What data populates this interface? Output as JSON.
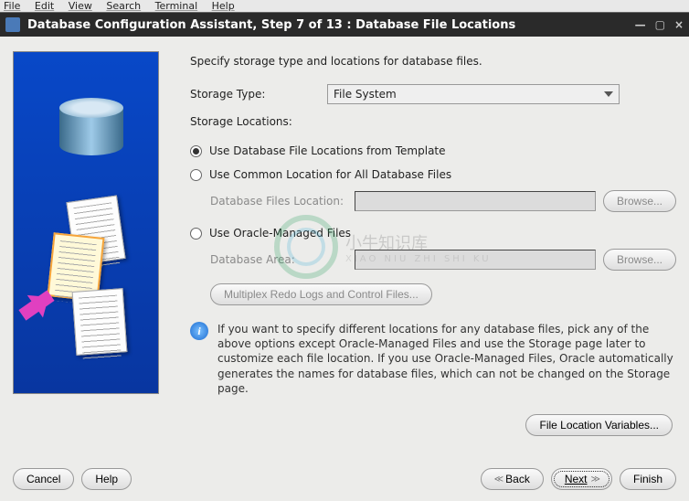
{
  "menubar": [
    "File",
    "Edit",
    "View",
    "Search",
    "Terminal",
    "Help"
  ],
  "window": {
    "title": "Database Configuration Assistant, Step 7 of 13 : Database File Locations"
  },
  "instruction": "Specify storage type and locations for database files.",
  "storage_type": {
    "label": "Storage Type:",
    "value": "File System"
  },
  "storage_locations_label": "Storage Locations:",
  "radios": {
    "template": "Use Database File Locations from Template",
    "common": "Use Common Location for All Database Files",
    "omf": "Use Oracle-Managed Files"
  },
  "common": {
    "label": "Database Files Location:",
    "value": "",
    "browse": "Browse..."
  },
  "omf": {
    "label": "Database Area:",
    "value": "",
    "browse": "Browse..."
  },
  "multiplex": "Multiplex Redo Logs and Control Files...",
  "info": "If you want to specify different locations for any database files, pick any of the above options except Oracle-Managed Files and use the Storage page later to customize each file location. If you use Oracle-Managed Files, Oracle automatically generates the names for database files, which can not be changed on the Storage page.",
  "file_loc_vars": "File Location Variables...",
  "footer": {
    "cancel": "Cancel",
    "help": "Help",
    "back": "Back",
    "next": "Next",
    "finish": "Finish"
  },
  "watermark": {
    "main": "小牛知识库",
    "sub": "XIAO NIU ZHI SHI KU"
  }
}
